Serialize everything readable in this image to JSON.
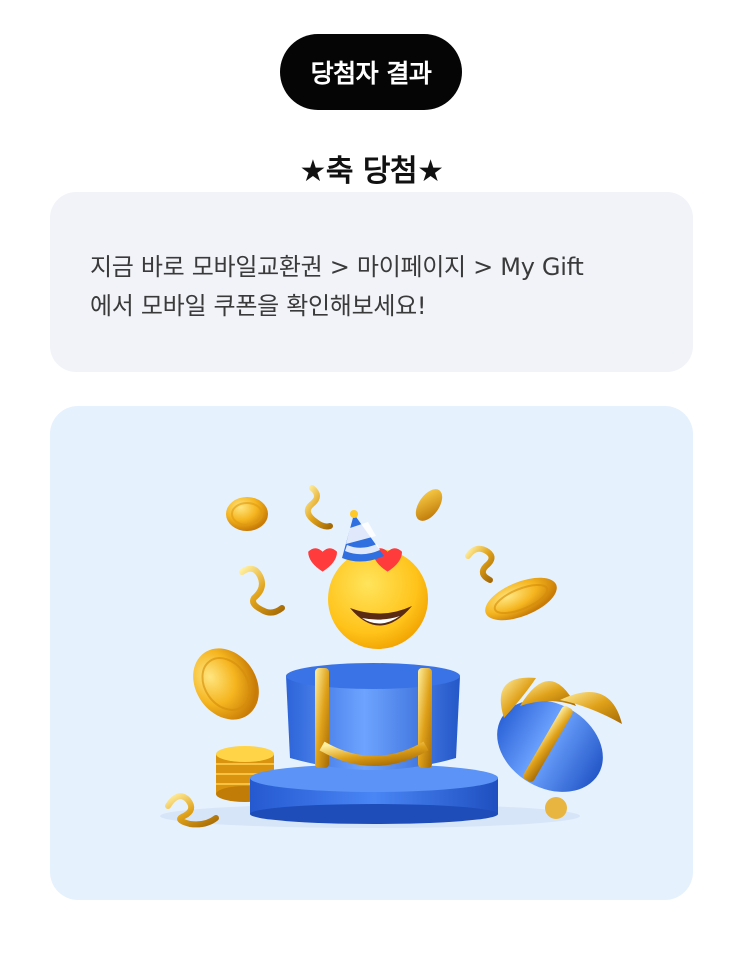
{
  "header": {
    "result_label": "당첨자 결과"
  },
  "title": "★축 당첨★",
  "info": {
    "message": "지금 바로 모바일교환권 > 마이페이지 > My Gift\n에서 모바일 쿠폰을 확인해보세요!"
  },
  "illustration": {
    "icons": [
      "coin-icon",
      "confetti-icon",
      "party-hat-icon",
      "heart-eyes-emoji-icon",
      "gift-box-icon",
      "ribbon-bow-icon",
      "podium-icon",
      "coin-stack-icon"
    ],
    "colors": {
      "background": "#e6f1fe",
      "gold": "#f5b51f",
      "blue": "#3f7ef0",
      "emoji": "#ffc928"
    }
  }
}
